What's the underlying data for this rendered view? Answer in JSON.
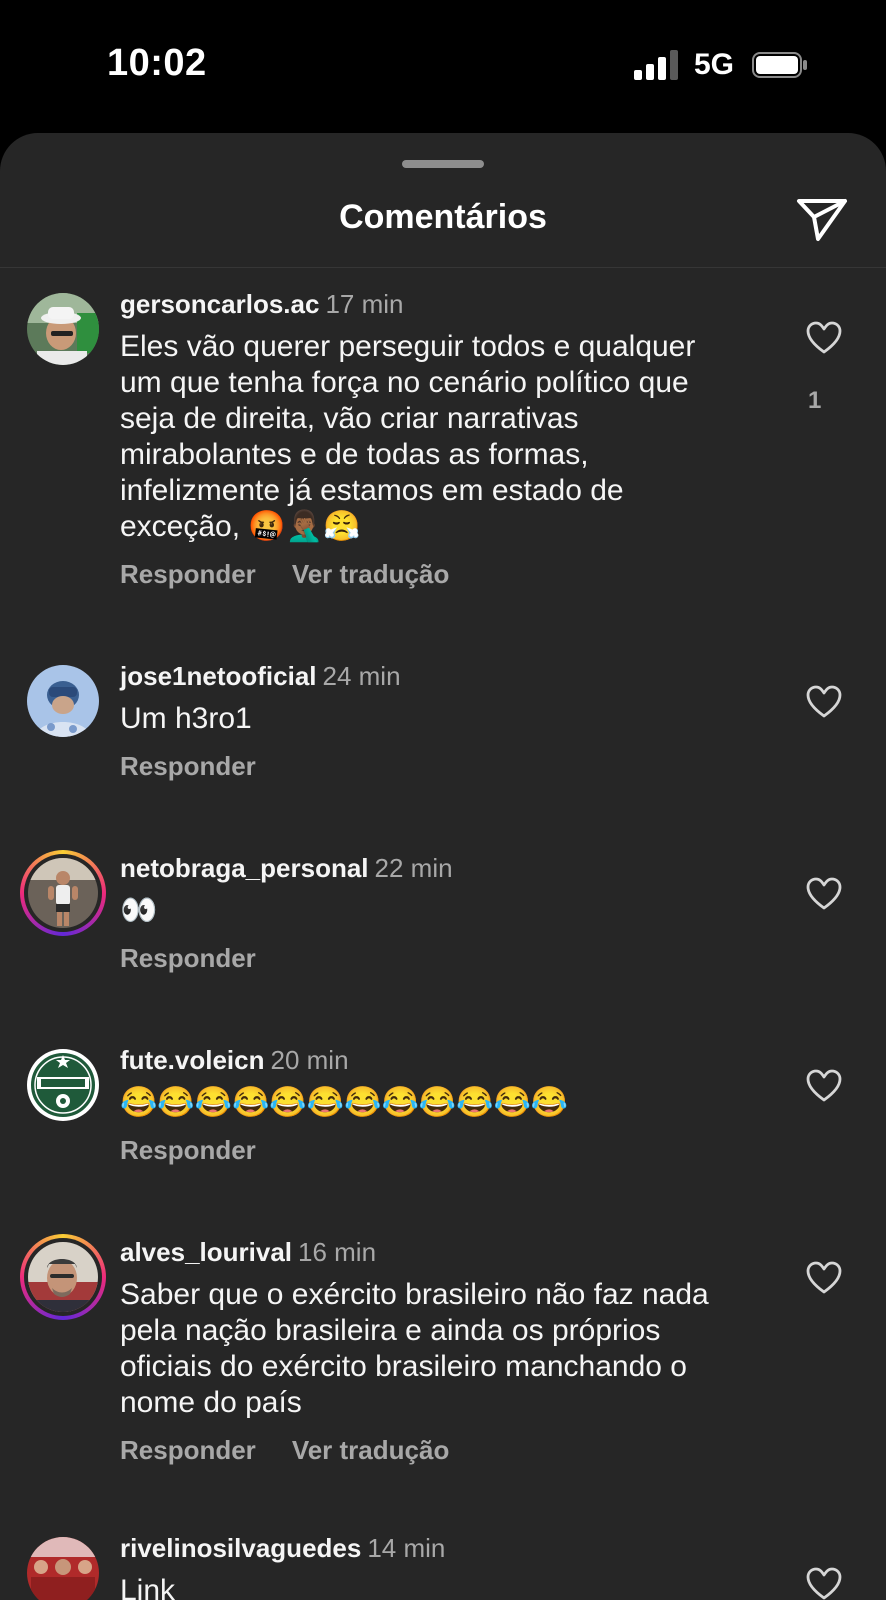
{
  "status_bar": {
    "time": "10:02",
    "network": "5G"
  },
  "header": {
    "title": "Comentários"
  },
  "comments": [
    {
      "username": "gersoncarlos.ac",
      "time": "17 min",
      "text": "Eles vão querer perseguir todos e qualquer um que tenha força no cenário político que seja de direita, vão criar narrativas mirabolantes e de todas as formas, infelizmente já estamos em estado de exceção, 🤬🤦🏾‍♂️😤",
      "reply": "Responder",
      "translate": "Ver tradução",
      "likes": "1"
    },
    {
      "username": "jose1netooficial",
      "time": "24 min",
      "text": "Um h3ro1",
      "reply": "Responder"
    },
    {
      "username": "netobraga_personal",
      "time": "22 min",
      "text": "👀",
      "reply": "Responder"
    },
    {
      "username": "fute.voleicn",
      "time": "20 min",
      "text": "😂😂😂😂😂😂😂😂😂😂😂😂",
      "reply": "Responder"
    },
    {
      "username": "alves_lourival",
      "time": "16 min",
      "text": "Saber que o exército brasileiro não faz nada pela nação brasileira e ainda os próprios oficiais do exército brasileiro manchando o nome do país",
      "reply": "Responder",
      "translate": "Ver tradução"
    },
    {
      "username": "rivelinosilvaguedes",
      "time": "14 min",
      "text": "Link"
    }
  ],
  "icons": {
    "share": "paper-plane-icon",
    "like": "heart-outline-icon"
  },
  "colors": {
    "sheet": "#262626",
    "secondary_text": "#a8a8a8"
  }
}
